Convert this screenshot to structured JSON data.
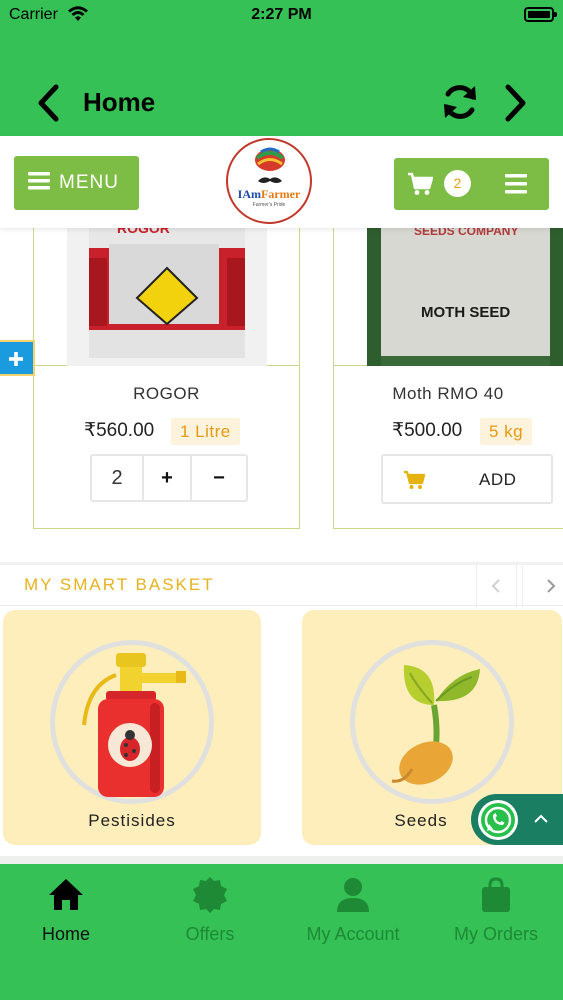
{
  "status_bar": {
    "carrier": "Carrier",
    "time": "2:27 PM"
  },
  "nav": {
    "title": "Home",
    "back_icon": "chevron-left-icon",
    "refresh_icon": "refresh-icon",
    "forward_icon": "chevron-right-icon"
  },
  "header": {
    "menu_label": "MENU",
    "logo": {
      "name_part1": "IAm",
      "name_part2": "Farmer",
      "tagline": "Farmer's Pride"
    },
    "cart_count": "2"
  },
  "products": [
    {
      "name": "ROGOR",
      "price": "₹560.00",
      "unit": "1 Litre",
      "quantity": "2",
      "image_text": "ROGOR"
    },
    {
      "name": "Moth RMO 40",
      "price": "₹500.00",
      "unit": "5 kg",
      "add_label": "ADD",
      "image_text_top": "SEEDS COMPANY",
      "image_text_main": "MOTH SEED"
    }
  ],
  "smart_basket": {
    "title": "MY SMART BASKET",
    "items": [
      {
        "label": "Pestisides",
        "icon": "pesticide-sprayer-icon"
      },
      {
        "label": "Seeds",
        "icon": "seedling-icon"
      }
    ]
  },
  "tabs": [
    {
      "label": "Home",
      "icon": "home-icon",
      "active": true
    },
    {
      "label": "Offers",
      "icon": "offer-badge-icon",
      "active": false
    },
    {
      "label": "My Account",
      "icon": "user-icon",
      "active": false
    },
    {
      "label": "My Orders",
      "icon": "shopping-bag-icon",
      "active": false
    }
  ],
  "colors": {
    "primary_green": "#35c155",
    "button_green": "#7dbd46",
    "accent_gold": "#e6b21e",
    "whatsapp": "#1a7f62",
    "side_plus": "#1a9be0"
  }
}
